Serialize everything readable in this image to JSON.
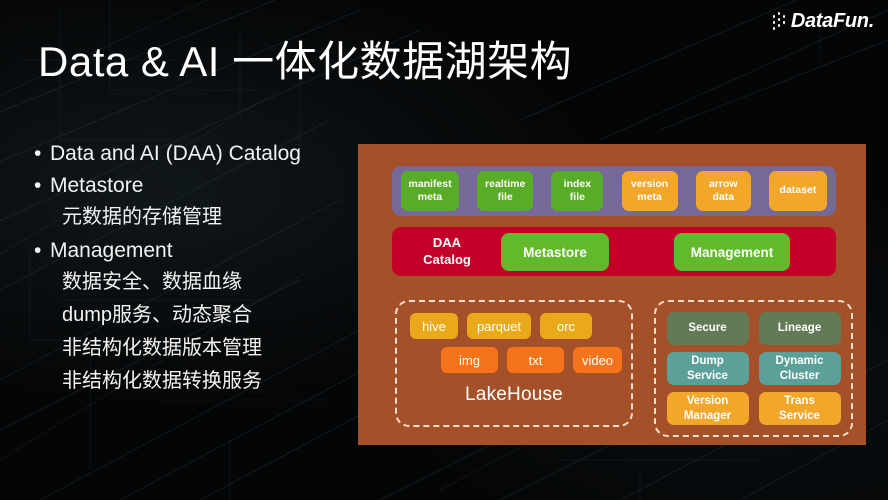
{
  "slide": {
    "title": "Data & AI 一体化数据湖架构",
    "background_color": "#040506"
  },
  "logo": {
    "wordmark": "DataFun.",
    "icon": "datafun-dots-logo"
  },
  "bullets": [
    {
      "marker": "•",
      "text": "Data and AI (DAA) Catalog"
    },
    {
      "marker": "•",
      "text": "Metastore"
    }
  ],
  "sub_items_1": [
    "元数据的存储管理"
  ],
  "bullets2": [
    {
      "marker": "•",
      "text": "Management"
    }
  ],
  "sub_items_2": [
    "数据安全、数据血缘",
    "dump服务、动态聚合",
    "非结构化数据版本管理",
    "非结构化数据转换服务"
  ],
  "diagram": {
    "panel_color": "#a4512a",
    "meta_band": {
      "background": "#77689a",
      "chips": [
        {
          "lines": [
            "manifest",
            "meta"
          ],
          "color": "#58ac26",
          "kind": "green"
        },
        {
          "lines": [
            "realtime",
            "file"
          ],
          "color": "#58ac26",
          "kind": "green"
        },
        {
          "lines": [
            "index",
            "file"
          ],
          "color": "#58ac26",
          "kind": "green"
        },
        {
          "lines": [
            "version",
            "meta"
          ],
          "color": "#f2a72a",
          "kind": "amber"
        },
        {
          "lines": [
            "arrow",
            "data"
          ],
          "color": "#f2a72a",
          "kind": "amber"
        },
        {
          "lines": [
            "dataset"
          ],
          "color": "#f2a72a",
          "kind": "amber"
        }
      ]
    },
    "catalog_band": {
      "background": "#c20028",
      "label_lines": [
        "DAA",
        "Catalog"
      ],
      "boxes": [
        {
          "label": "Metastore",
          "color": "#62b92b"
        },
        {
          "label": "Management",
          "color": "#62b92b"
        }
      ]
    },
    "lakehouse": {
      "title": "LakeHouse",
      "formats": [
        {
          "label": "hive",
          "color": "#e9a91b",
          "width": 48
        },
        {
          "label": "parquet",
          "color": "#e9a91b",
          "width": 64
        },
        {
          "label": "orc",
          "color": "#e9a91b",
          "width": 52
        }
      ],
      "media": [
        {
          "label": "img",
          "color": "#f5741b",
          "width": 57
        },
        {
          "label": "txt",
          "color": "#f5741b",
          "width": 57
        },
        {
          "label": "video",
          "color": "#f5741b",
          "width": 49
        }
      ]
    },
    "services": [
      [
        {
          "lines": [
            "Secure"
          ],
          "color": "#627a56",
          "kind": "sage"
        },
        {
          "lines": [
            "Lineage"
          ],
          "color": "#627a56",
          "kind": "sage"
        }
      ],
      [
        {
          "lines": [
            "Dump",
            "Service"
          ],
          "color": "#5ba099",
          "kind": "teal"
        },
        {
          "lines": [
            "Dynamic",
            "Cluster"
          ],
          "color": "#5ba099",
          "kind": "teal"
        }
      ],
      [
        {
          "lines": [
            "Version",
            "Manager"
          ],
          "color": "#f2a72a",
          "kind": "amber2"
        },
        {
          "lines": [
            "Trans",
            "Service"
          ],
          "color": "#f2a72a",
          "kind": "amber2"
        }
      ]
    ]
  }
}
